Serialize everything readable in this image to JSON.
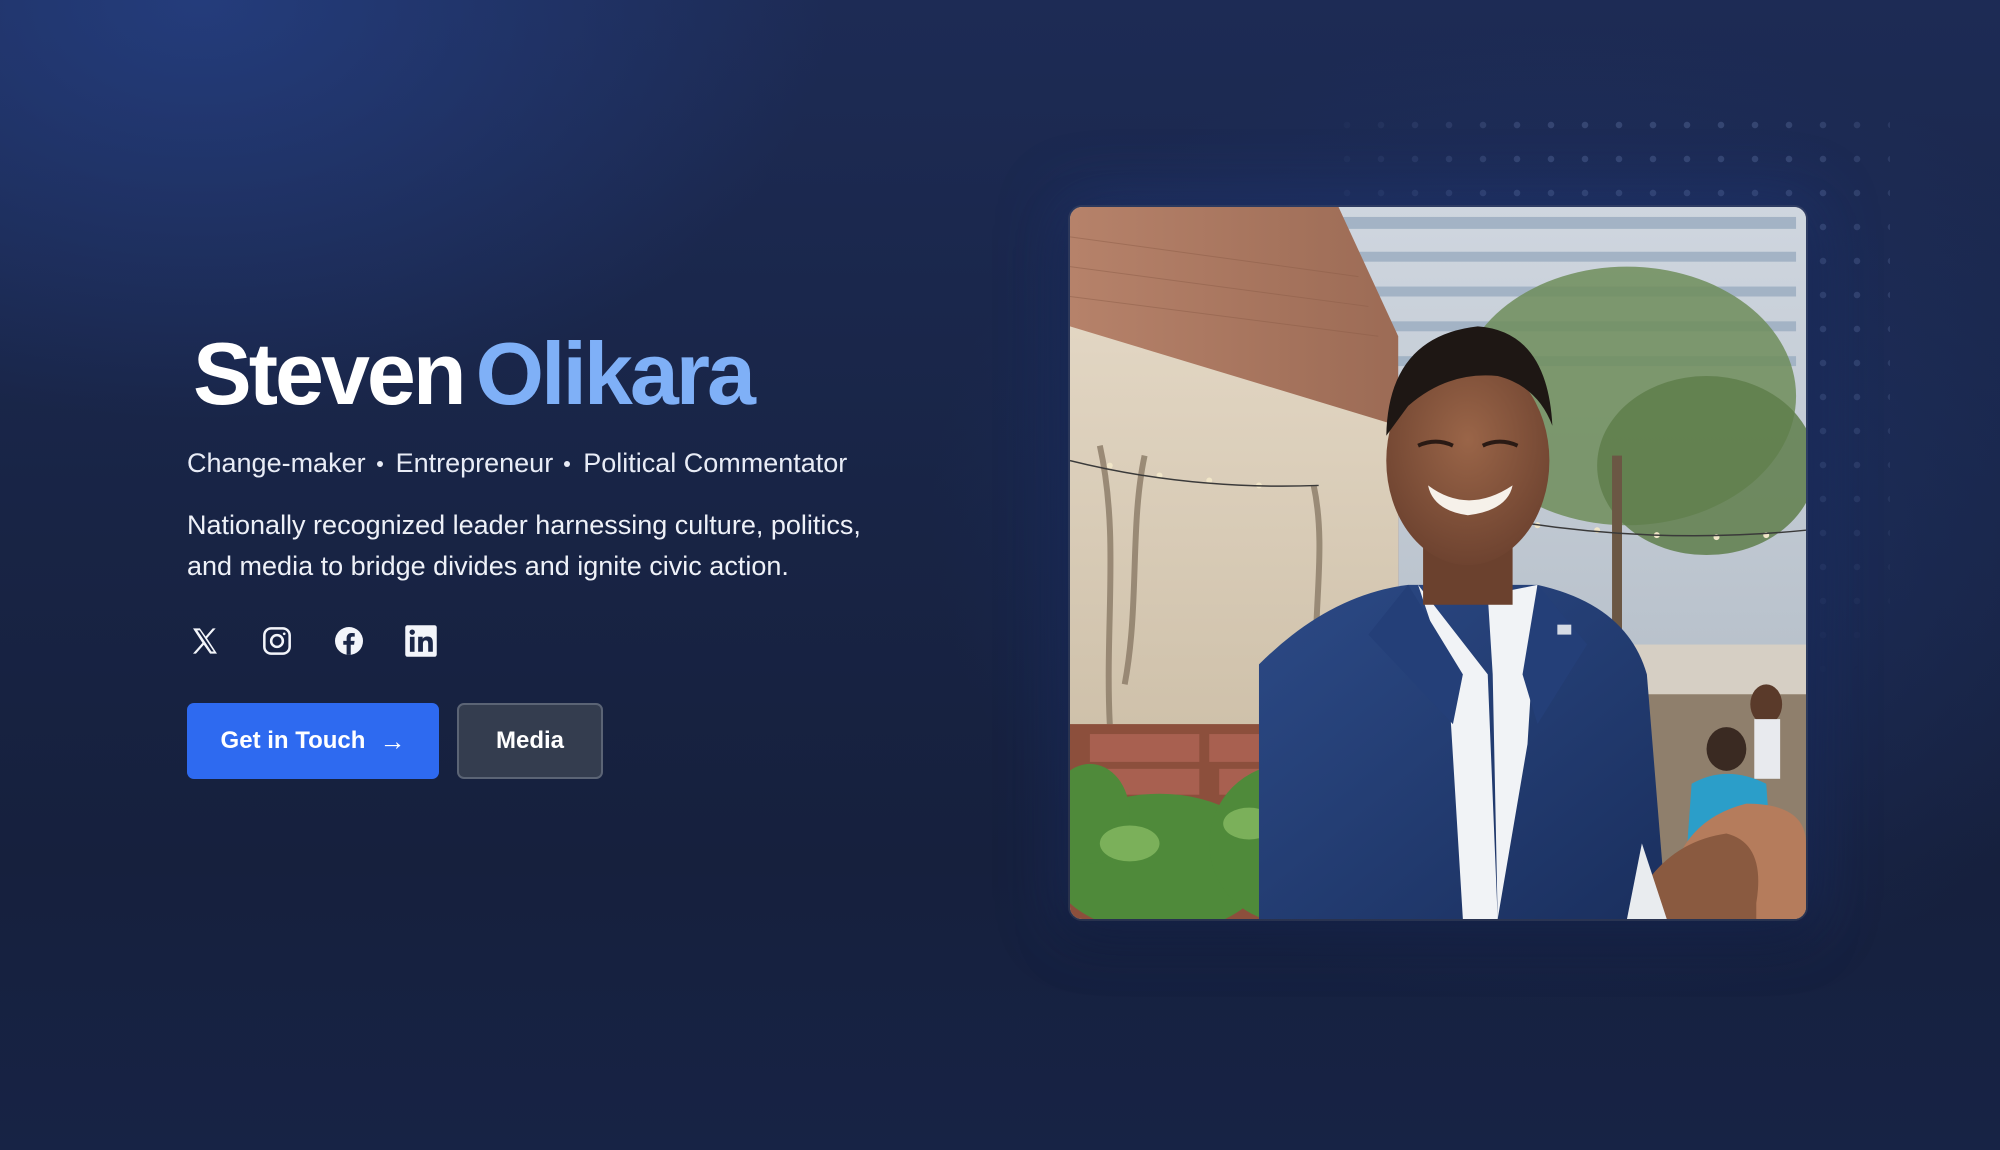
{
  "hero": {
    "first_name": "Steven",
    "last_name": "Olikara",
    "roles": [
      "Change-maker",
      "Entrepreneur",
      "Political Commentator"
    ],
    "description": "Nationally recognized leader harnessing culture, politics, and media to bridge divides and ignite civic action.",
    "socials": [
      {
        "icon": "x-icon"
      },
      {
        "icon": "instagram-icon"
      },
      {
        "icon": "facebook-icon"
      },
      {
        "icon": "linkedin-icon"
      }
    ],
    "primary_button": {
      "label": "Get in Touch",
      "arrow": "→"
    },
    "secondary_button": {
      "label": "Media"
    },
    "photo": {
      "alt": "Steven Olikara"
    }
  },
  "colors": {
    "background": "#1a2547",
    "accent_name": "#7fb0f7",
    "primary_button": "#2e6af0",
    "secondary_button": "#343d4f"
  }
}
